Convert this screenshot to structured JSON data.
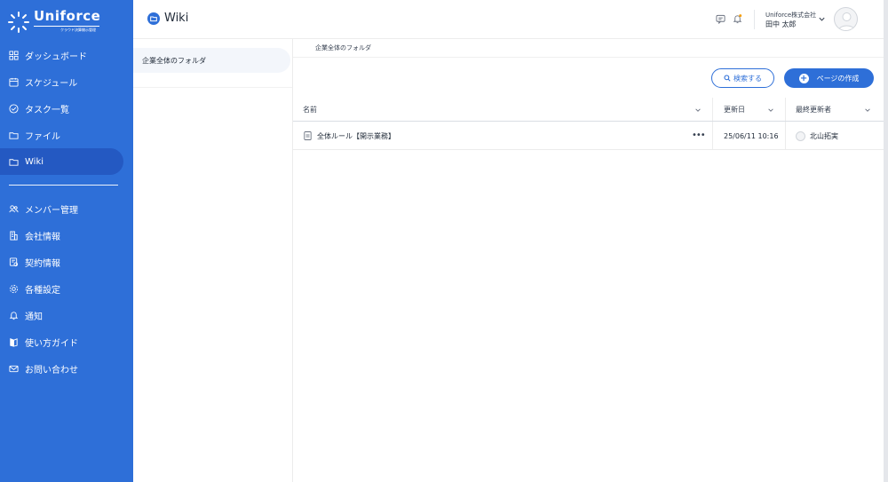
{
  "brand": {
    "name": "Uniforce",
    "tagline": "クラウド決算開示管理"
  },
  "sidebar": {
    "items": [
      {
        "label": "ダッシュボード",
        "icon": "grid-icon"
      },
      {
        "label": "スケジュール",
        "icon": "calendar-icon"
      },
      {
        "label": "タスク一覧",
        "icon": "check-circle-icon"
      },
      {
        "label": "ファイル",
        "icon": "folder-icon"
      },
      {
        "label": "Wiki",
        "icon": "folder-icon",
        "active": true
      }
    ],
    "items2": [
      {
        "label": "メンバー管理",
        "icon": "users-icon"
      },
      {
        "label": "会社情報",
        "icon": "building-icon"
      },
      {
        "label": "契約情報",
        "icon": "contract-icon"
      },
      {
        "label": "各種設定",
        "icon": "gear-icon"
      },
      {
        "label": "通知",
        "icon": "bell-icon"
      },
      {
        "label": "使い方ガイド",
        "icon": "book-icon"
      },
      {
        "label": "お問い合わせ",
        "icon": "mail-icon"
      }
    ]
  },
  "header": {
    "title": "Wiki",
    "company": "Uniforce株式会社",
    "user": "田中 太郎"
  },
  "folders": {
    "items": [
      "企業全体のフォルダ"
    ]
  },
  "breadcrumb": "企業全体のフォルダ",
  "actions": {
    "search": "検索する",
    "create": "ページの作成"
  },
  "table": {
    "columns": [
      "名前",
      "更新日",
      "最終更新者"
    ],
    "rows": [
      {
        "name": "全体ルール【開示業務】",
        "updated": "25/06/11 10:16",
        "updater": "北山拓実"
      }
    ]
  },
  "colors": {
    "primary": "#2e6fd8",
    "active_nav": "#2459c2",
    "notification_dot": "#f59e0b"
  }
}
